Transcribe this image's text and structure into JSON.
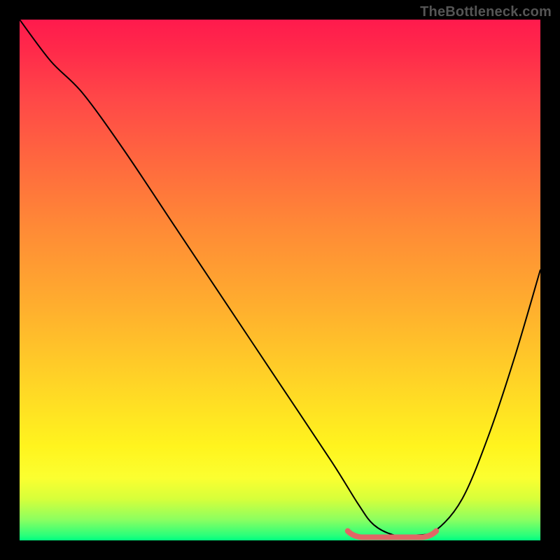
{
  "watermark": "TheBottleneck.com",
  "colors": {
    "background": "#000000",
    "curve": "#000000",
    "trough": "#e06666",
    "gradient_top": "#ff1a4d",
    "gradient_bottom": "#00ff80"
  },
  "chart_data": {
    "type": "line",
    "title": "",
    "xlabel": "",
    "ylabel": "",
    "xlim": [
      0,
      100
    ],
    "ylim": [
      0,
      100
    ],
    "grid": false,
    "series": [
      {
        "name": "curve",
        "x": [
          0,
          6,
          12,
          20,
          30,
          40,
          50,
          60,
          65,
          68,
          72,
          76,
          80,
          85,
          90,
          95,
          100
        ],
        "values": [
          100,
          92,
          86,
          75,
          60,
          45,
          30,
          15,
          7,
          3,
          1,
          1,
          2,
          8,
          20,
          35,
          52
        ]
      }
    ],
    "trough": {
      "x_start": 63,
      "x_end": 80,
      "y_level": 1
    }
  }
}
